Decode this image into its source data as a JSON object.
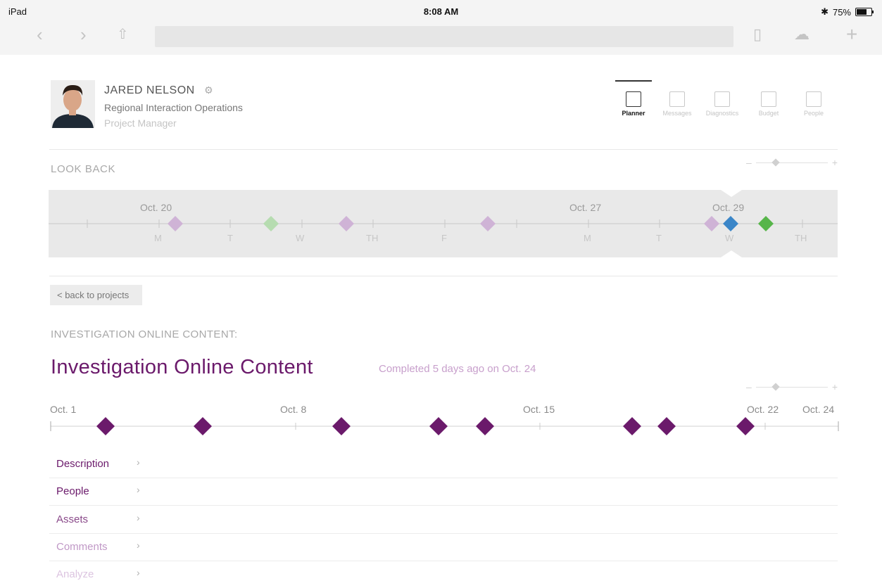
{
  "status_bar": {
    "device": "iPad",
    "time": "8:08 AM",
    "battery": "75%",
    "battery_level": 0.75
  },
  "user": {
    "name": "JARED NELSON",
    "org": "Regional Interaction Operations",
    "role": "Project Manager"
  },
  "nav": {
    "items": [
      {
        "label": "Planner",
        "icon": "calendar-icon",
        "active": true
      },
      {
        "label": "Messages",
        "icon": "message-icon",
        "active": false
      },
      {
        "label": "Diagnostics",
        "icon": "diagnostics-icon",
        "active": false
      },
      {
        "label": "Budget",
        "icon": "budget-icon",
        "active": false
      },
      {
        "label": "People",
        "icon": "people-icon",
        "active": false
      }
    ]
  },
  "look_back": {
    "title": "LOOK BACK",
    "dates": [
      "Oct. 20",
      "Oct. 27",
      "Oct. 29"
    ],
    "days": [
      "M",
      "T",
      "W",
      "TH",
      "F",
      "M",
      "T",
      "W",
      "TH"
    ]
  },
  "back_button": "< back to projects",
  "project": {
    "heading": "INVESTIGATION ONLINE CONTENT:",
    "title": "Investigation Online Content",
    "status": "Completed 5 days ago on Oct. 24",
    "timeline_dates": [
      "Oct. 1",
      "Oct. 8",
      "Oct. 15",
      "Oct. 22",
      "Oct. 24"
    ]
  },
  "details": [
    {
      "label": "Description",
      "color": "#6b1a6b"
    },
    {
      "label": "People",
      "color": "#6b1a6b"
    },
    {
      "label": "Assets",
      "color": "#8a4a8a"
    },
    {
      "label": "Comments",
      "color": "#c098c6"
    },
    {
      "label": "Analyze",
      "color": "#dcc4e0"
    }
  ],
  "colors": {
    "brand": "#6b1a6b",
    "lookback_diamond": "#cfb3d6",
    "green_light": "#b6dcb0",
    "green": "#57b54a",
    "blue": "#3b86c8"
  }
}
